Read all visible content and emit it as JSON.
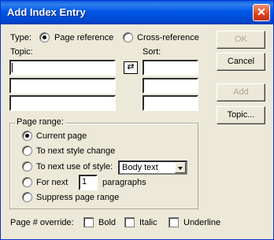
{
  "window": {
    "title": "Add Index Entry",
    "close_glyph": "✕"
  },
  "type": {
    "label": "Type:",
    "options": [
      {
        "label": "Page reference",
        "selected": true
      },
      {
        "label": "Cross-reference",
        "selected": false
      }
    ]
  },
  "topic": {
    "label": "Topic:",
    "values": [
      "",
      "",
      ""
    ]
  },
  "sort": {
    "label": "Sort:",
    "values": [
      "",
      "",
      ""
    ]
  },
  "swap_glyph": "⇄",
  "buttons": {
    "ok": "OK",
    "cancel": "Cancel",
    "add": "Add",
    "topic": "Topic..."
  },
  "page_range": {
    "title": "Page range:",
    "options": [
      {
        "label": "Current page",
        "selected": true
      },
      {
        "label": "To next style change",
        "selected": false
      },
      {
        "label": "To next use of style:",
        "selected": false
      },
      {
        "label": "For  next",
        "selected": false
      },
      {
        "label": "Suppress page range",
        "selected": false
      }
    ],
    "style_value": "Body text",
    "next_count": "1",
    "paragraphs_label": "paragraphs"
  },
  "override": {
    "label": "Page # override:",
    "options": [
      {
        "label": "Bold",
        "checked": false
      },
      {
        "label": "Italic",
        "checked": false
      },
      {
        "label": "Underline",
        "checked": false
      }
    ]
  }
}
